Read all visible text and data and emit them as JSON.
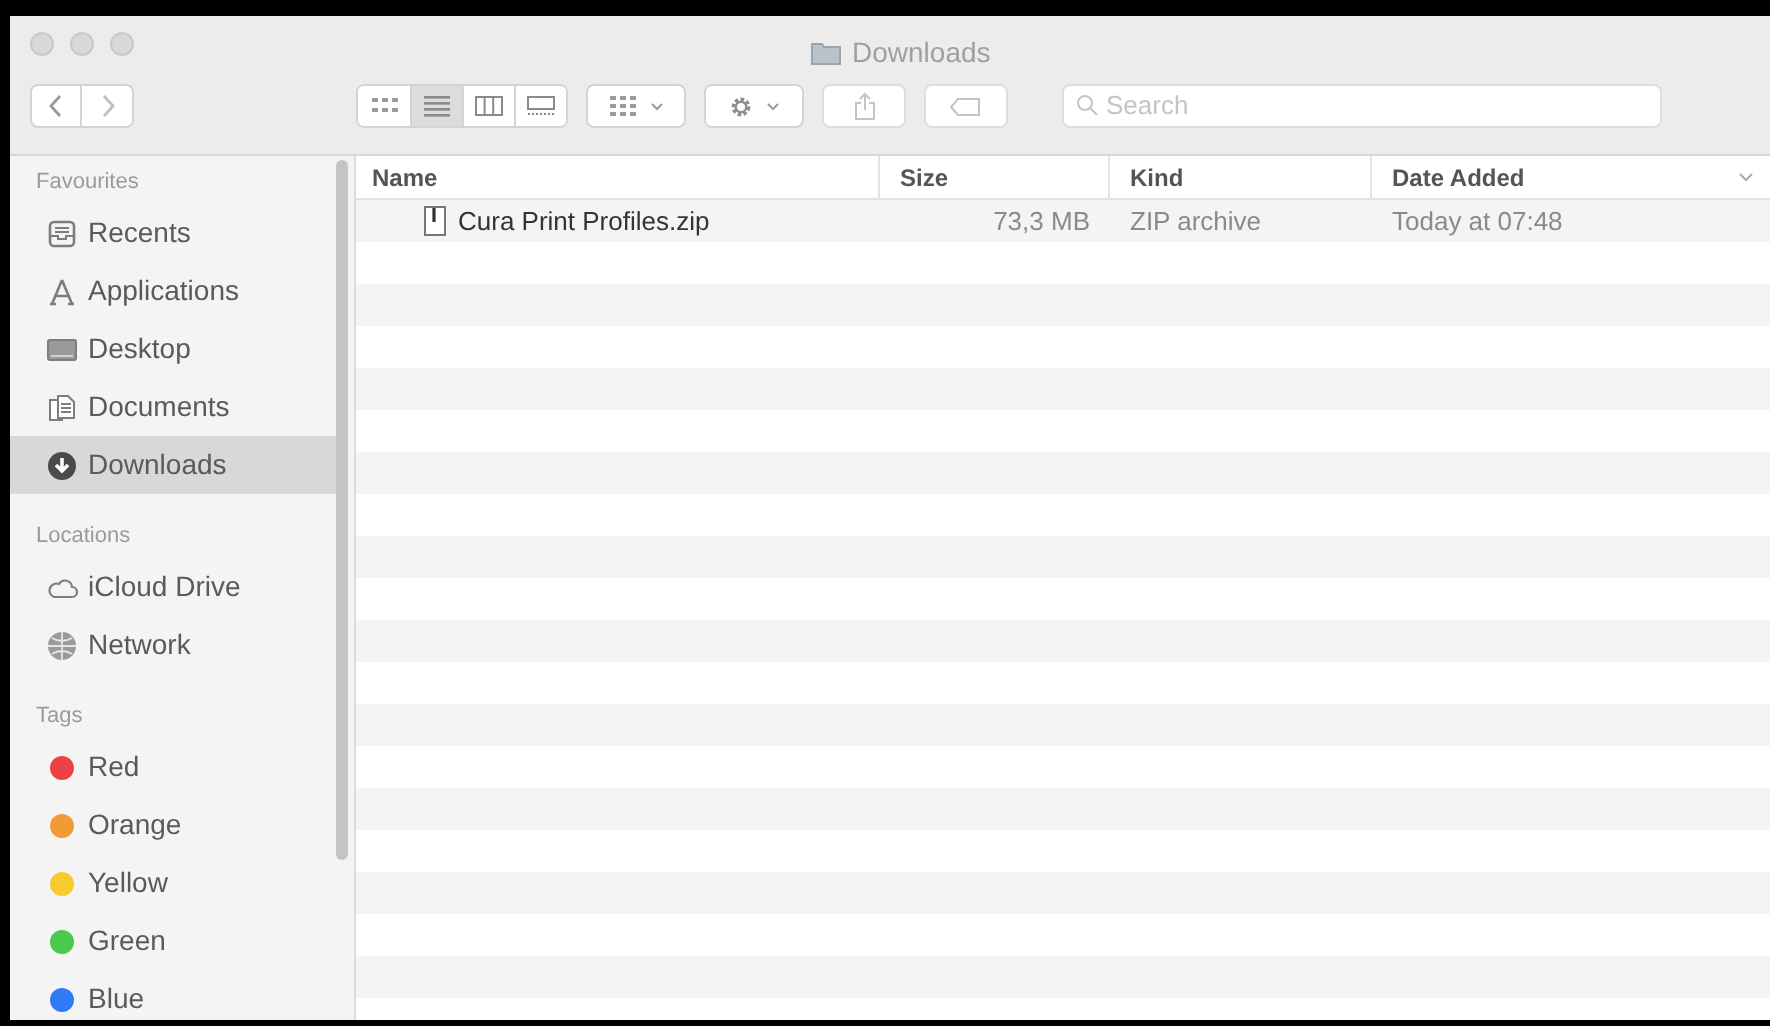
{
  "window": {
    "title": "Downloads"
  },
  "toolbar": {
    "views": [
      {
        "kind": "icons",
        "selected": false
      },
      {
        "kind": "list",
        "selected": true
      },
      {
        "kind": "columns",
        "selected": false
      },
      {
        "kind": "gallery",
        "selected": false
      }
    ],
    "search": {
      "placeholder": "Search"
    }
  },
  "sidebar": {
    "sections": [
      {
        "title": "Favourites",
        "items": [
          {
            "label": "Recents",
            "selected": false
          },
          {
            "label": "Applications",
            "selected": false
          },
          {
            "label": "Desktop",
            "selected": false
          },
          {
            "label": "Documents",
            "selected": false
          },
          {
            "label": "Downloads",
            "selected": true
          }
        ]
      },
      {
        "title": "Locations",
        "items": [
          {
            "label": "iCloud Drive",
            "selected": false
          },
          {
            "label": "Network",
            "selected": false
          }
        ]
      },
      {
        "title": "Tags",
        "items": [
          {
            "label": "Red",
            "color": "#ec4245",
            "selected": false
          },
          {
            "label": "Orange",
            "color": "#f29a38",
            "selected": false
          },
          {
            "label": "Yellow",
            "color": "#f6cb2f",
            "selected": false
          },
          {
            "label": "Green",
            "color": "#4ac94f",
            "selected": false
          },
          {
            "label": "Blue",
            "color": "#2f7bf5",
            "selected": false
          }
        ]
      }
    ]
  },
  "table": {
    "columns": [
      "Name",
      "Size",
      "Kind",
      "Date Added"
    ],
    "rows": [
      {
        "cells": [
          "Cura Print Profiles.zip",
          "73,3 MB",
          "ZIP archive",
          "Today at 07:48"
        ],
        "selected": false
      }
    ]
  }
}
